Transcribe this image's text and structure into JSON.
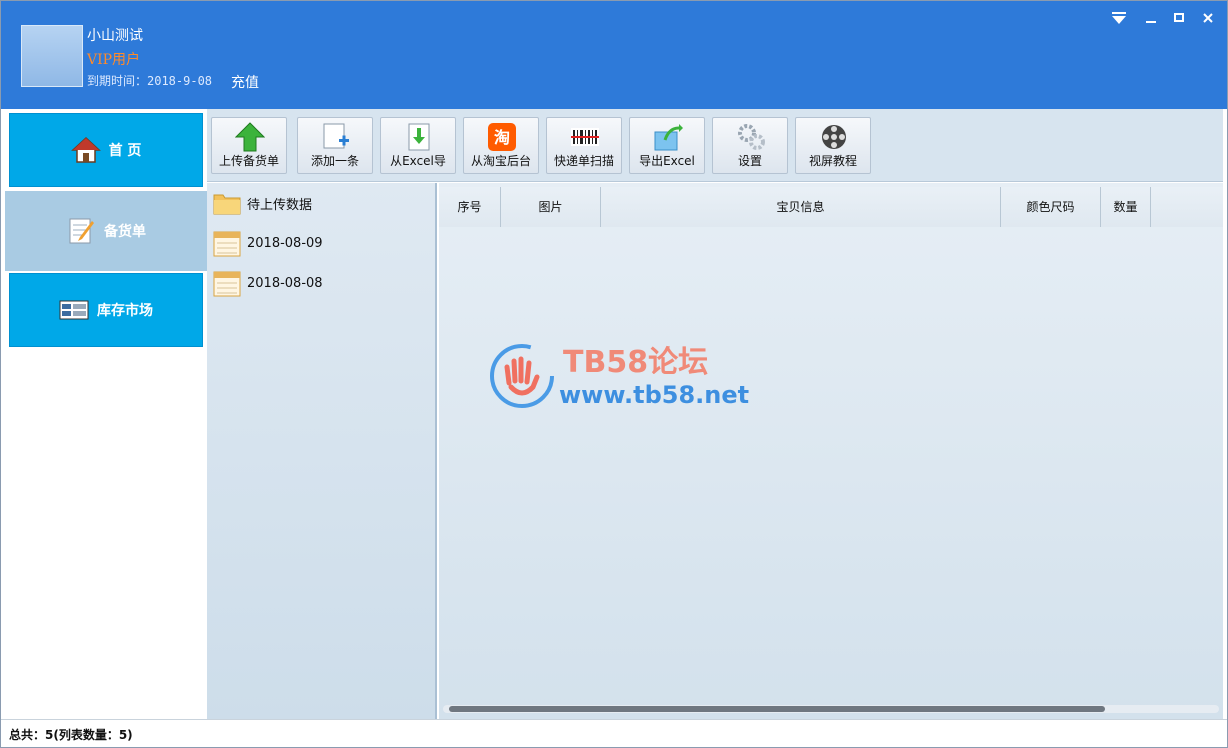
{
  "header": {
    "username": "小山测试",
    "vip_label": "VIP用户",
    "expire_text": "到期时间：2018-9-08",
    "recharge_label": "充值",
    "controls": {
      "dropdown": "▼",
      "minimize": "—",
      "maximize": "▫",
      "close": "✕"
    }
  },
  "nav": {
    "home_label": "首 页",
    "stock_label": "备货单",
    "market_label": "库存市场"
  },
  "toolbar": {
    "buttons": [
      {
        "label": "上传备货单",
        "icon": "upload-arrow-icon"
      },
      {
        "label": "添加一条",
        "icon": "add-document-icon"
      },
      {
        "label": "从Excel导",
        "icon": "excel-import-icon"
      },
      {
        "label": "从淘宝后台",
        "icon": "taobao-icon"
      },
      {
        "label": "快递单扫描",
        "icon": "barcode-icon"
      },
      {
        "label": "导出Excel",
        "icon": "export-icon"
      },
      {
        "label": "设置",
        "icon": "gear-icon"
      },
      {
        "label": "视屏教程",
        "icon": "film-reel-icon"
      }
    ]
  },
  "tree": {
    "items": [
      {
        "label": "待上传数据",
        "icon": "folder-icon"
      },
      {
        "label": "2018-08-09",
        "icon": "calendar-icon"
      },
      {
        "label": "2018-08-08",
        "icon": "calendar-icon"
      }
    ]
  },
  "table": {
    "columns": [
      "序号",
      "图片",
      "宝贝信息",
      "颜色尺码",
      "数量"
    ]
  },
  "watermark": {
    "title": "TB58论坛",
    "url": "www.tb58.net"
  },
  "status": {
    "text": "总共：5(列表数量：5)"
  },
  "colors": {
    "header_bg": "#2e7ad9",
    "nav_active": "#00a8e8",
    "nav_selected": "#a9cbe3",
    "vip": "#ff8a2a"
  }
}
